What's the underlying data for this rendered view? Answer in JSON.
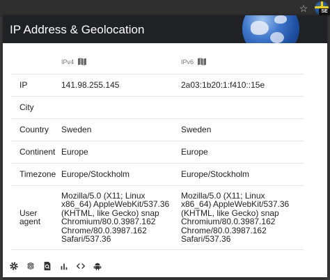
{
  "popup": {
    "title": "IP Address & Geolocation"
  },
  "browser": {
    "extension_badge": "SE"
  },
  "columns": {
    "ipv4": "IPv4",
    "ipv6": "IPv6"
  },
  "rows": [
    {
      "label": "IP",
      "ipv4": "141.98.255.145",
      "ipv6": "2a03:1b20:1:f410::15e"
    },
    {
      "label": "City",
      "ipv4": "",
      "ipv6": ""
    },
    {
      "label": "Country",
      "ipv4": "Sweden",
      "ipv6": "Sweden"
    },
    {
      "label": "Continent",
      "ipv4": "Europe",
      "ipv6": "Europe"
    },
    {
      "label": "Timezone",
      "ipv4": "Europe/Stockholm",
      "ipv6": "Europe/Stockholm"
    },
    {
      "label": "User agent",
      "ipv4": "Mozilla/5.0 (X11; Linux x86_64) AppleWebKit/537.36 (KHTML, like Gecko) snap Chromium/80.0.3987.162 Chrome/80.0.3987.162 Safari/537.36",
      "ipv6": "Mozilla/5.0 (X11; Linux x86_64) AppleWebKit/537.36 (KHTML, like Gecko) snap Chromium/80.0.3987.162 Chrome/80.0.3987.162 Safari/537.36"
    }
  ],
  "toolbar": [
    "gear-icon",
    "fingerprint-icon",
    "search-page-icon",
    "bar-chart-icon",
    "code-icon",
    "android-icon"
  ],
  "colors": {
    "header_bg": "#202124",
    "accent": "#1d4fa0"
  }
}
